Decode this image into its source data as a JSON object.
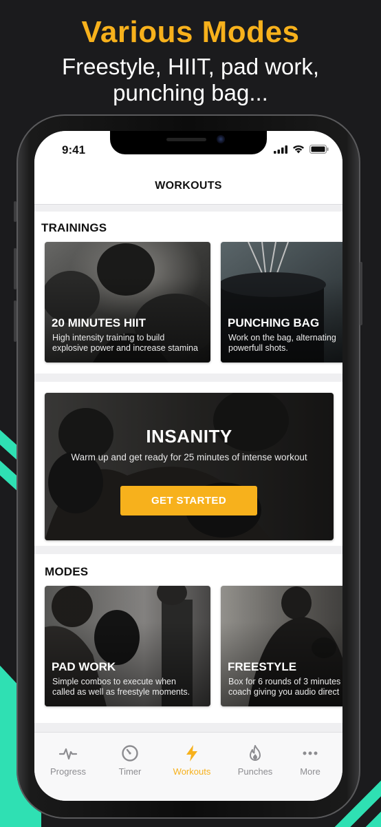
{
  "promo": {
    "title": "Various Modes",
    "subtitle_line1": "Freestyle, HIIT, pad work,",
    "subtitle_line2": "punching bag..."
  },
  "status_bar": {
    "time": "9:41"
  },
  "nav": {
    "title": "WORKOUTS"
  },
  "trainings": {
    "label": "TRAININGS",
    "cards": [
      {
        "title": "20 MINUTES HIIT",
        "desc_line1": "High intensity training to build",
        "desc_line2": "explosive power and increase stamina"
      },
      {
        "title": "PUNCHING BAG",
        "desc_line1": "Work on the bag, alternating",
        "desc_line2": "powerfull shots."
      }
    ]
  },
  "featured": {
    "title": "INSANITY",
    "subtitle": "Warm up and get ready for 25 minutes of intense workout",
    "button_label": "GET STARTED"
  },
  "modes": {
    "label": "MODES",
    "cards": [
      {
        "title": "PAD WORK",
        "desc_line1": "Simple combos to execute when",
        "desc_line2": "called as well as freestyle moments."
      },
      {
        "title": "FREESTYLE",
        "desc_line1": "Box for 6 rounds of 3 minutes",
        "desc_line2": "coach giving you audio direct"
      }
    ]
  },
  "tabs": [
    {
      "label": "Progress",
      "icon": "pulse-icon"
    },
    {
      "label": "Timer",
      "icon": "timer-icon"
    },
    {
      "label": "Workouts",
      "icon": "lightning-icon"
    },
    {
      "label": "Punches",
      "icon": "flame-icon"
    },
    {
      "label": "More",
      "icon": "more-dots-icon"
    }
  ],
  "colors": {
    "accent": "#f7b11c",
    "teal": "#2fe0b3",
    "background": "#1b1b1d",
    "tab_inactive": "#8c8c90"
  }
}
